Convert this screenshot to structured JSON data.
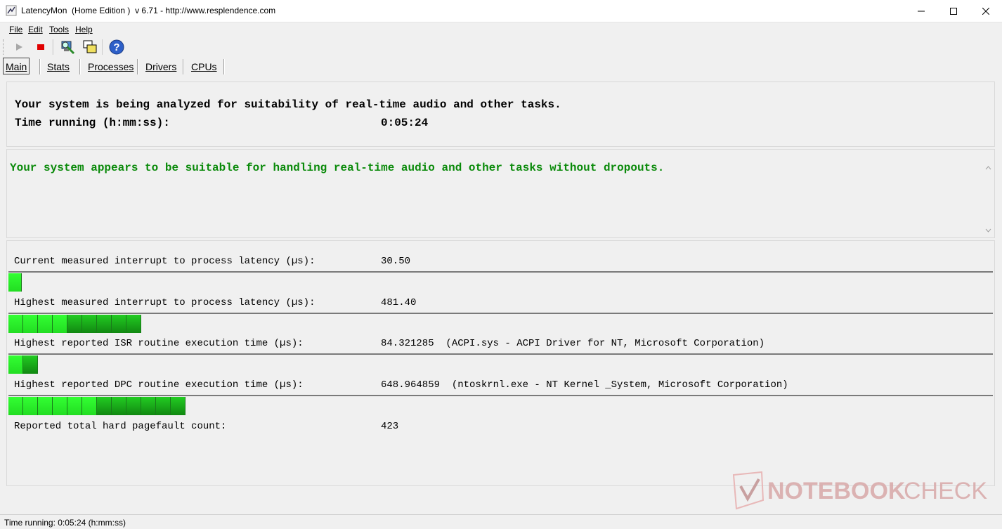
{
  "window": {
    "title": "LatencyMon  (Home Edition )  v 6.71 - http://www.resplendence.com"
  },
  "menu": [
    "File",
    "Edit",
    "Tools",
    "Help"
  ],
  "toolbar_icons": [
    "play-icon",
    "stop-icon",
    "monitor-icon",
    "windows-icon",
    "help-icon"
  ],
  "tabs": [
    "Main",
    "Stats",
    "Processes",
    "Drivers",
    "CPUs"
  ],
  "analysis": {
    "headline": "Your system is being analyzed for suitability of real-time audio and other tasks.",
    "time_label": "Time running (h:mm:ss):",
    "time_value": "0:05:24"
  },
  "conclusion": {
    "text": "Your system appears to be suitable for handling real-time audio and other tasks without dropouts.",
    "color": "#0a8a0a"
  },
  "metrics": [
    {
      "label": "Current measured interrupt to process latency (µs):",
      "value": "30.50",
      "bar_segments": 1
    },
    {
      "label": "Highest measured interrupt to process latency (µs):",
      "value": "481.40",
      "bar_segments": 9
    },
    {
      "label": "Highest reported ISR routine execution time (µs):",
      "value": "84.321285  (ACPI.sys - ACPI Driver for NT, Microsoft Corporation)",
      "bar_segments": 2
    },
    {
      "label": "Highest reported DPC routine execution time (µs):",
      "value": "648.964859  (ntoskrnl.exe - NT Kernel _System, Microsoft Corporation)",
      "bar_segments": 12
    },
    {
      "label": "Reported total hard pagefault count:",
      "value": "423",
      "bar_segments": 0
    }
  ],
  "status": {
    "text": "Time running: 0:05:24  (h:mm:ss)"
  },
  "watermark": {
    "text_bold": "NOTEBOOK",
    "text_light": "CHECK"
  },
  "colors": {
    "bar_light": "#33ff33",
    "bar_dark": "#118811",
    "stop": "#e00000"
  }
}
